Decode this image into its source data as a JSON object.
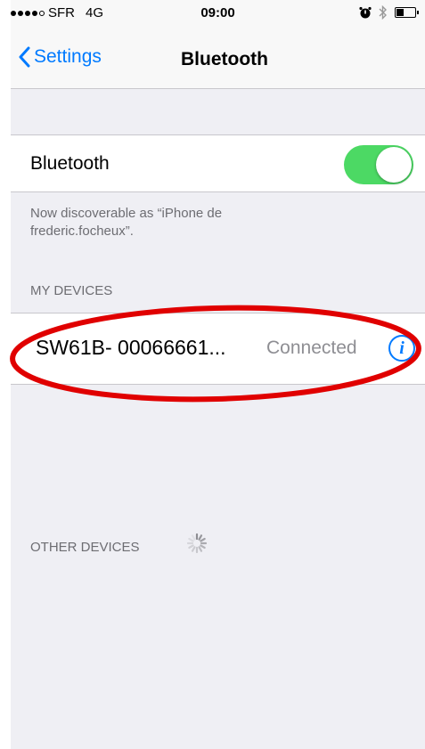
{
  "status_bar": {
    "carrier": "SFR",
    "network": "4G",
    "time": "09:00",
    "battery_level": 0.4
  },
  "nav": {
    "back_label": "Settings",
    "title": "Bluetooth"
  },
  "bluetooth": {
    "label": "Bluetooth",
    "enabled": true,
    "toggle_color": "#4cd964",
    "discoverable_note": "Now discoverable as “iPhone de frederic.focheux”."
  },
  "my_devices": {
    "header": "MY DEVICES",
    "devices": [
      {
        "name": "SW61B- 00066661...",
        "status": "Connected"
      }
    ]
  },
  "other_devices": {
    "header": "OTHER DEVICES",
    "searching": true
  },
  "colors": {
    "accent": "#007aff",
    "highlight_circle": "#e00000"
  }
}
